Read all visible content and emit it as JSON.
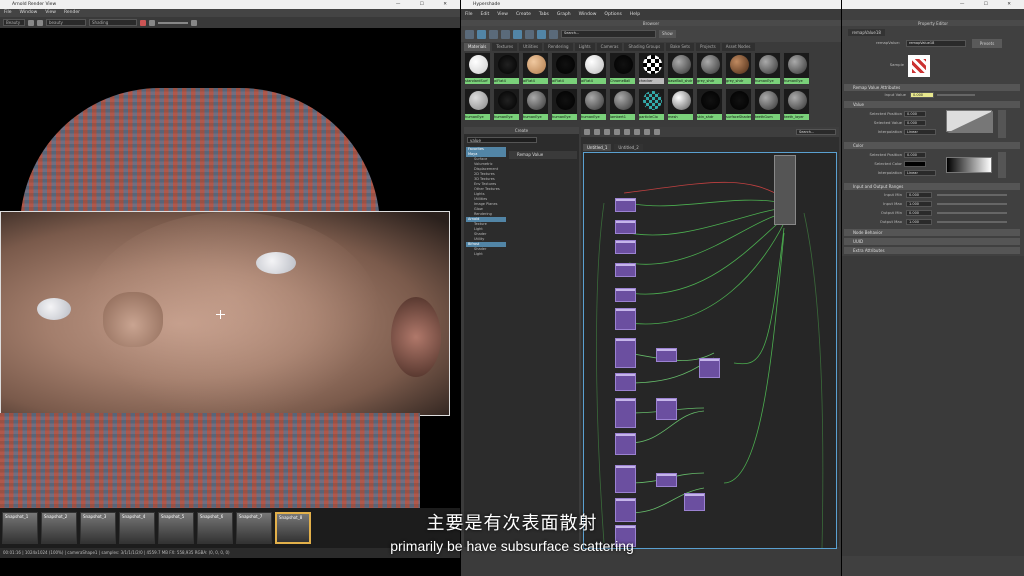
{
  "arnold": {
    "title": "Arnold Render View",
    "menu": [
      "File",
      "Window",
      "View",
      "Render"
    ],
    "toolbar": {
      "camera": "Beauty",
      "aov": "beauty",
      "view": "Shading"
    },
    "snapshots": [
      "Snapshot_1",
      "Snapshot_2",
      "Snapshot_3",
      "Snapshot_4",
      "Snapshot_5",
      "Snapshot_6",
      "Snapshot_7",
      "Snapshot_8"
    ],
    "status": "00:01:16 | 1024x1024 (100%) | cameraShape1 | samples: 3/1/1/1/2/0 | 4559.7 MB  FX: 558,935 RGBA: (0, 0, 0, 0)"
  },
  "hypershade": {
    "title": "Hypershade",
    "menu": [
      "File",
      "Edit",
      "View",
      "Create",
      "Tabs",
      "Graph",
      "Window",
      "Options",
      "Help"
    ],
    "browser_title": "Browser",
    "search_placeholder": "Search...",
    "show_label": "Show",
    "tabs": [
      "Materials",
      "Textures",
      "Utilities",
      "Rendering",
      "Lights",
      "Cameras",
      "Shading Groups",
      "Bake Sets",
      "Projects",
      "Asset Nodes"
    ],
    "swatches_row1": [
      "standardSurf",
      "aiFlat4",
      "aiFlat4",
      "aiFlat4",
      "aiFlat4",
      "ChromeBall",
      "checker",
      "baseBall_shdr",
      "grey_shdr",
      "grey_shdr",
      "humanEye",
      "humanEye"
    ],
    "swatches_row2": [
      "humanEye",
      "humanEye",
      "humanEye",
      "humanEye",
      "humanEye",
      "lambert1",
      "particleClo",
      "mesh",
      "skin_shdr",
      "surfaceShader",
      "teethGum",
      "teeth_layer"
    ],
    "create_title": "Create",
    "create_search": "value",
    "create_tree": [
      "Favorites",
      "Maya",
      "Surface",
      "Volumetric",
      "Displacement",
      "2D Textures",
      "3D Textures",
      "Env Textures",
      "Other Textures",
      "Lights",
      "Utilities",
      "Image Planes",
      "Glow",
      "Rendering",
      "Arnold",
      "Texture",
      "Light",
      "Shader",
      "Utility",
      "Bifrost",
      "Shader",
      "Light"
    ],
    "create_result": "Remap Value",
    "graph_tabs": [
      "Untitled_1",
      "Untitled_2"
    ],
    "graph_search_placeholder": "Search..."
  },
  "attribute_editor": {
    "title": "Property Editor",
    "node_tab": "remapValue18",
    "node_label": "remapValue:",
    "node_name": "remapValue18",
    "presets": "Presets",
    "sample_label": "Sample",
    "sections": [
      "Remap Value Attributes",
      "Value",
      "Color",
      "Input and Output Ranges",
      "Node Behavior",
      "UUID",
      "Extra Attributes"
    ],
    "input_value_label": "Input Value",
    "input_value": "0.000",
    "value_fields": [
      {
        "label": "Selected Position",
        "value": "0.000"
      },
      {
        "label": "Selected Value",
        "value": "0.000"
      },
      {
        "label": "Interpolation",
        "value": "Linear"
      }
    ],
    "color_fields": [
      {
        "label": "Selected Position",
        "value": "0.000"
      },
      {
        "label": "Selected Color",
        "value": ""
      },
      {
        "label": "Interpolation",
        "value": "Linear"
      }
    ],
    "range_fields": [
      {
        "label": "Input Min",
        "value": "0.000"
      },
      {
        "label": "Input Max",
        "value": "1.000"
      },
      {
        "label": "Output Min",
        "value": "0.000"
      },
      {
        "label": "Output Max",
        "value": "1.000"
      }
    ]
  },
  "subtitles": {
    "zh": "主要是有次表面散射",
    "en": "primarily be have subsurface scattering"
  }
}
